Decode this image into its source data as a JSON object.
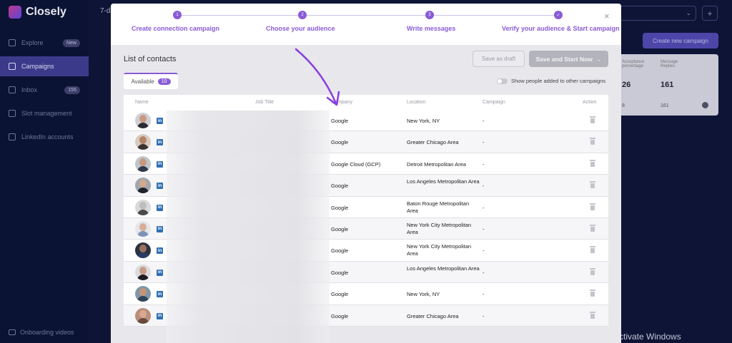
{
  "background": {
    "logo_text": "Closely",
    "top_left_text": "7-d",
    "nav": [
      {
        "label": "Explore",
        "badge": "New",
        "icon": "compass-icon",
        "active": false
      },
      {
        "label": "Campaigns",
        "badge": "",
        "icon": "megaphone-icon",
        "active": true
      },
      {
        "label": "Inbox",
        "badge": "155",
        "icon": "inbox-icon",
        "active": false
      },
      {
        "label": "Slot management",
        "badge": "",
        "icon": "gear-icon",
        "active": false
      },
      {
        "label": "LinkedIn accounts",
        "badge": "",
        "icon": "linkedin-icon",
        "active": false
      }
    ],
    "bottom_link": "Onboarding videos",
    "create_button": "Create new campaign",
    "card_col1": "Acceptance percentage",
    "card_col2": "Message Replies",
    "card_val1": "26",
    "card_val2": "161",
    "card_row2_a": "8",
    "card_row2_b": "161",
    "watermark": "Activate Windows"
  },
  "modal": {
    "steps": [
      {
        "num": "1",
        "label": "Create connection campaign"
      },
      {
        "num": "2",
        "label": "Choose your audience"
      },
      {
        "num": "3",
        "label": "Write messages"
      },
      {
        "num": "✓",
        "label": "Verify your audience & Start campaign"
      }
    ],
    "close": "×",
    "list_title": "List of contacts",
    "save_draft": "Save as draft",
    "save_start": "Save and Start Now",
    "save_start_arrow": "→",
    "tab_label": "Available",
    "tab_count": "10",
    "toggle_label": "Show people added to other campaigns",
    "columns": [
      "Name",
      "Job Title",
      "Company",
      "Location",
      "Campaign",
      "Action"
    ],
    "rows": [
      {
        "company": "Google",
        "location": "New York, NY",
        "campaign": "-",
        "avatar_bg": "#cfcfd4",
        "skin": "#c99b82",
        "shirt": "#2b2b33"
      },
      {
        "company": "Google",
        "location": "Greater Chicago Area",
        "campaign": "-",
        "avatar_bg": "#d7cbbf",
        "skin": "#b48468",
        "shirt": "#3a3230"
      },
      {
        "company": "Google Cloud (GCP)",
        "location": "Detroit Metropolitan Area",
        "campaign": "-",
        "avatar_bg": "#bfc5cc",
        "skin": "#c89a80",
        "shirt": "#2f3a4a"
      },
      {
        "company": "Google",
        "location": "Los Angeles Metropolitan Area",
        "campaign": "-",
        "avatar_bg": "#a0a6ad",
        "skin": "#d2a88e",
        "shirt": "#1f242c"
      },
      {
        "company": "Google",
        "location": "Baton Rouge Metropolitan Area",
        "campaign": "-",
        "avatar_bg": "#d9d9dc",
        "skin": "#bdbdbd",
        "shirt": "#4a4a4a"
      },
      {
        "company": "Google",
        "location": "New York City Metropolitan Area",
        "campaign": "-",
        "avatar_bg": "#e4e6ea",
        "skin": "#d8ae98",
        "shirt": "#7b93b8"
      },
      {
        "company": "Google",
        "location": "New York City Metropolitan Area",
        "campaign": "-",
        "avatar_bg": "#2d3240",
        "skin": "#9a7262",
        "shirt": "#2a3c66"
      },
      {
        "company": "Google",
        "location": "Los Angeles Metropolitan Area",
        "campaign": "-",
        "avatar_bg": "#dcdcdf",
        "skin": "#c69c86",
        "shirt": "#1c1c22"
      },
      {
        "company": "Google",
        "location": "New York, NY",
        "campaign": "-",
        "avatar_bg": "#7f97a8",
        "skin": "#c59478",
        "shirt": "#2f4456"
      },
      {
        "company": "Google",
        "location": "Greater Chicago Area",
        "campaign": "-",
        "avatar_bg": "#b98e7a",
        "skin": "#d8a893",
        "shirt": "#6a4a3a"
      }
    ]
  },
  "colors": {
    "accent": "#8a5bd6",
    "background": "#0d1436",
    "linkedin": "#2f6fb5"
  }
}
